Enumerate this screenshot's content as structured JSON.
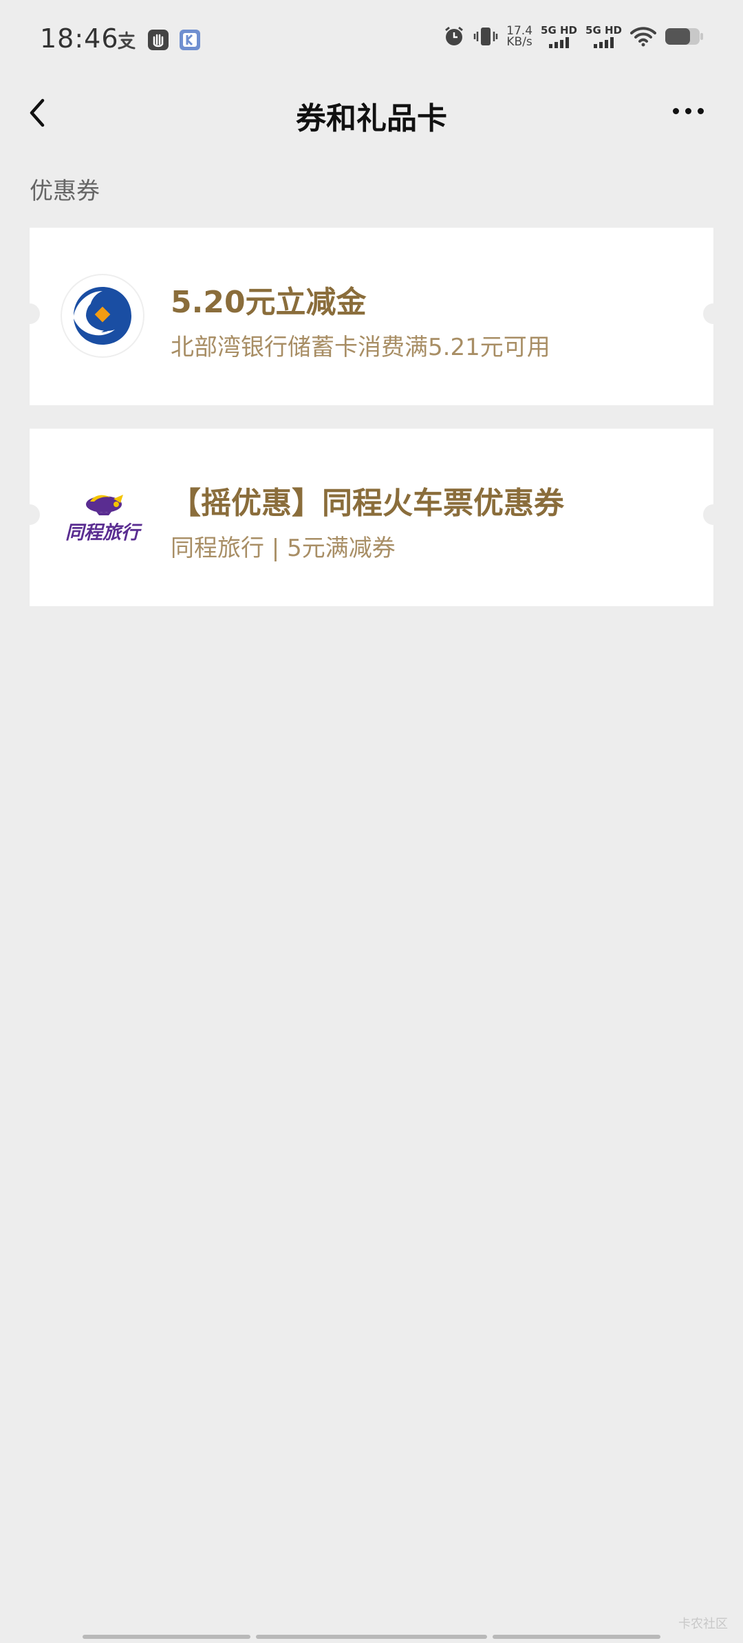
{
  "status_bar": {
    "time": "18:46",
    "net_speed_value": "17.4",
    "net_speed_unit": "KB/s",
    "sim1": "5G HD",
    "sim2": "5G HD"
  },
  "nav": {
    "title": "券和礼品卡"
  },
  "section": {
    "label": "优惠券"
  },
  "coupons": [
    {
      "title": "5.20元立减金",
      "subtitle": "北部湾银行储蓄卡消费满5.21元可用",
      "logo": "beibu-gulf-bank-logo"
    },
    {
      "title": "【摇优惠】同程火车票优惠券",
      "subtitle": "同程旅行 | 5元满减券",
      "logo": "tongcheng-travel-logo",
      "logo_text": "同程旅行"
    }
  ],
  "watermark": "卡农社区",
  "colors": {
    "background": "#ededed",
    "coupon_title": "#8a6d3b",
    "coupon_subtitle": "#a88e65",
    "bank_blue": "#1a4ea3",
    "tongcheng_purple": "#5a2d91"
  }
}
